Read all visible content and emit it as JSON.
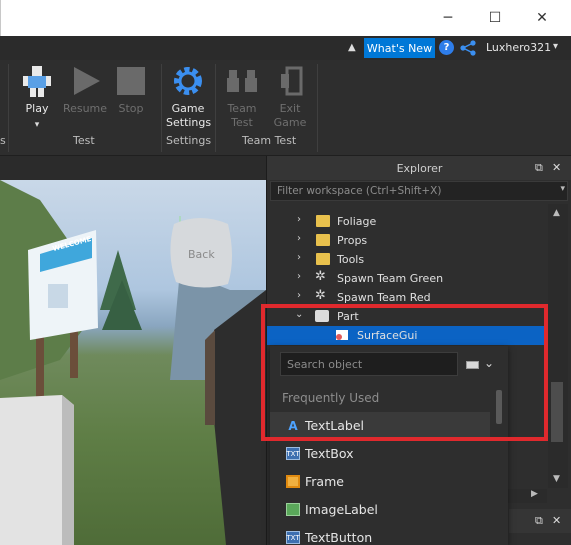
{
  "menubar": {
    "whats_new": "What's New",
    "username": "Luxhero321"
  },
  "ribbon": {
    "test_buttons": [
      {
        "label": "Play",
        "enabled": true
      },
      {
        "label": "Resume",
        "enabled": false
      },
      {
        "label": "Stop",
        "enabled": false
      }
    ],
    "test_group": "Test",
    "game_settings": {
      "line1": "Game",
      "line2": "Settings"
    },
    "settings_group": "Settings",
    "team_test": {
      "line1": "Team",
      "line2": "Test"
    },
    "exit_game": {
      "line1": "Exit",
      "line2": "Game"
    },
    "team_test_group": "Team Test"
  },
  "viewport": {
    "sign_text": "WELCOME",
    "back_label": "Back"
  },
  "explorer": {
    "title": "Explorer",
    "filter_placeholder": "Filter workspace (Ctrl+Shift+X)",
    "tree": [
      {
        "label": "Foliage",
        "icon": "folder-icon"
      },
      {
        "label": "Props",
        "icon": "folder-icon"
      },
      {
        "label": "Tools",
        "icon": "folder-icon"
      },
      {
        "label": "Spawn Team Green",
        "icon": "spawn-icon"
      },
      {
        "label": "Spawn Team Red",
        "icon": "spawn-icon"
      },
      {
        "label": "Part",
        "icon": "part-icon"
      },
      {
        "label": "SurfaceGui",
        "icon": "surfacegui-icon"
      }
    ]
  },
  "insert_popup": {
    "search_placeholder": "Search object",
    "frequently_used": "Frequently Used",
    "items": [
      {
        "label": "TextLabel",
        "icon": "textlabel-icon"
      },
      {
        "label": "TextBox",
        "icon": "textbox-icon"
      },
      {
        "label": "Frame",
        "icon": "frame-icon"
      },
      {
        "label": "ImageLabel",
        "icon": "imagelabel-icon"
      },
      {
        "label": "TextButton",
        "icon": "textbutton-icon"
      }
    ]
  },
  "colors": {
    "accent": "#0078d7",
    "selection": "#0b63c4",
    "highlight_box": "#e0292d"
  }
}
